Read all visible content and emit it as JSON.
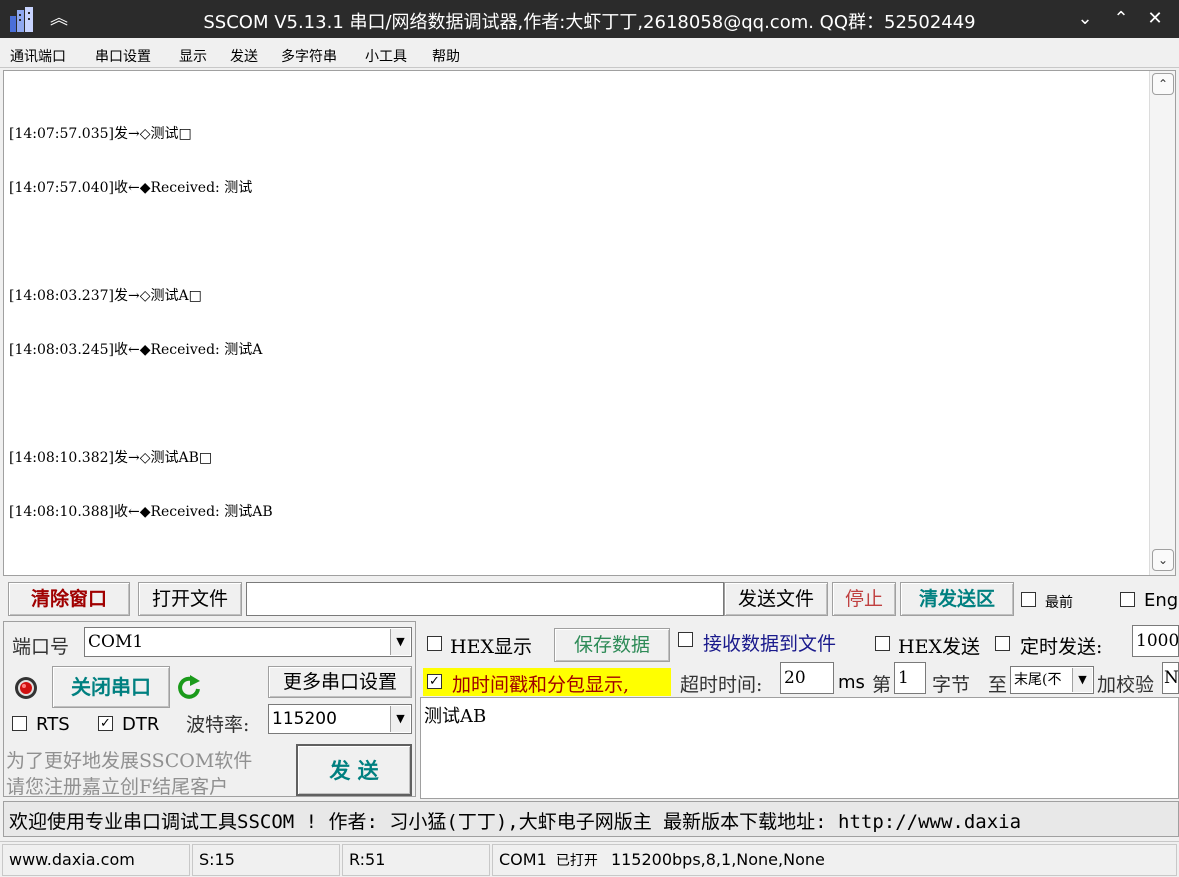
{
  "window": {
    "title": "SSCOM V5.13.1 串口/网络数据调试器,作者:大虾丁丁,2618058@qq.com. QQ群：52502449"
  },
  "menu": [
    "通讯端口",
    "串口设置",
    "显示",
    "发送",
    "多字符串",
    "小工具",
    "帮助"
  ],
  "receive": {
    "lines": [
      "[14:07:57.035]发→◇测试□",
      "[14:07:57.040]收←◆Received: 测试",
      "",
      "[14:08:03.237]发→◇测试A□",
      "[14:08:03.245]收←◆Received: 测试A",
      "",
      "[14:08:10.382]发→◇测试AB□",
      "[14:08:10.388]收←◆Received: 测试AB"
    ]
  },
  "toolbar": {
    "clear_window": "清除窗口",
    "open_file": "打开文件",
    "file_path": "",
    "send_file": "发送文件",
    "stop": "停止",
    "clear_send": "清发送区",
    "topmost": "最前",
    "english": "English"
  },
  "port": {
    "port_label": "端口号",
    "port_value": "COM1",
    "close_port": "关闭串口",
    "more_settings": "更多串口设置",
    "rts": "RTS",
    "dtr": "DTR",
    "rts_checked": false,
    "dtr_checked": true,
    "baud_label": "波特率:",
    "baud_value": "115200",
    "promo_line1": "为了更好地发展SSCOM软件",
    "promo_line2": "请您注册嘉立创F结尾客户",
    "send": "发  送"
  },
  "options": {
    "hex_display": "HEX显示",
    "save_data": "保存数据",
    "recv_to_file": "接收数据到文件",
    "hex_send": "HEX发送",
    "timed_send": "定时发送:",
    "timed_interval": "1000",
    "timestamp": "加时间戳和分包显示,",
    "timeout_label": "超时时间:",
    "timeout_value": "20",
    "ms": "ms",
    "nth": "第",
    "nth_value": "1",
    "byte": "字节",
    "to": "至",
    "end_value": "末尾(不",
    "checksum": "加校验",
    "checksum_value": "N"
  },
  "send_area": {
    "text": "测试AB"
  },
  "banner": {
    "text": "欢迎使用专业串口调试工具SSCOM ! 作者: 习小猛(丁丁),大虾电子网版主 最新版本下载地址: http://www.daxia"
  },
  "status": {
    "site": "www.daxia.com",
    "sent": "S:15",
    "received": "R:51",
    "port": "COM1",
    "port_state": "已打开",
    "params": "115200bps,8,1,None,None"
  },
  "colors": {
    "titlebar": "#2b2b2b",
    "clear_window_text": "#a00000",
    "stop_text": "#c04040",
    "clear_send_text": "#008080",
    "save_data_text": "#2e8b57",
    "recv_to_file_text": "#1a1a8c",
    "timestamp_bg": "#ffff00",
    "close_port_text": "#008080",
    "send_text": "#008080"
  }
}
